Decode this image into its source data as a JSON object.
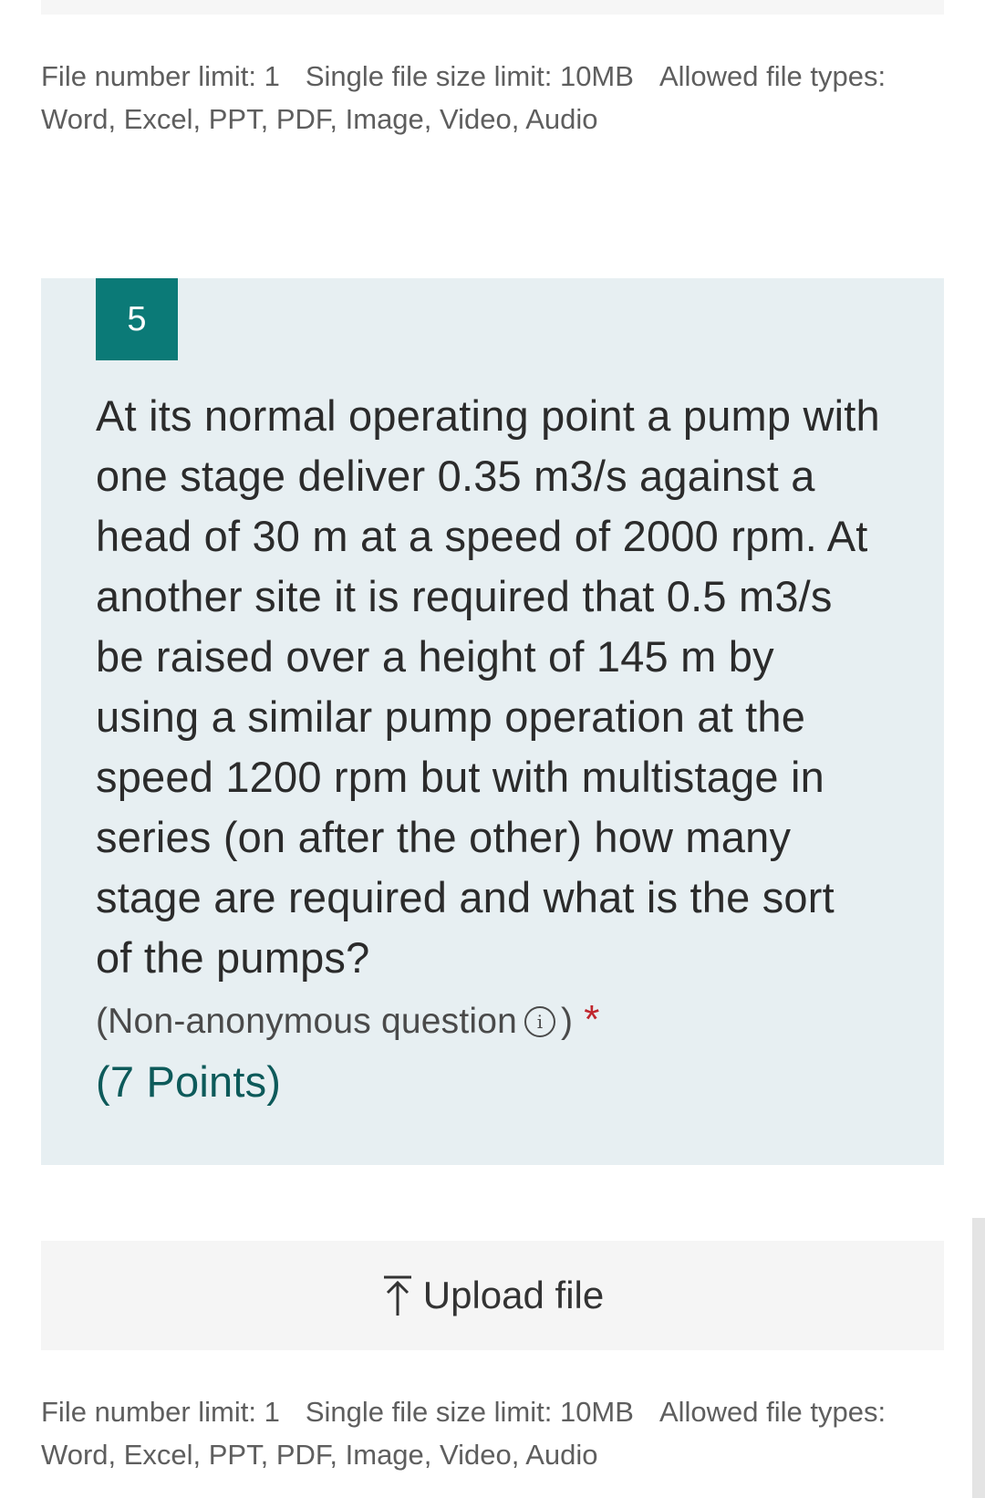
{
  "file_limits_top": {
    "number_limit": "File number limit: 1",
    "size_limit": "Single file size limit: 10MB",
    "types_label": "Allowed file types:",
    "types_value": "Word, Excel, PPT, PDF, Image, Video, Audio"
  },
  "question": {
    "number": "5",
    "text": "At its normal operating point a pump with one stage deliver 0.35 m3/s against a head of 30 m at a speed of 2000 rpm. At another site it is required that 0.5 m3/s be raised over a height of 145 m by using a similar pump operation at the  speed 1200 rpm but with multistage in series (on after the other) how many stage are required and what is the sort of the pumps?",
    "meta_open": "(Non-anonymous question",
    "info_icon_glyph": "i",
    "meta_close": ")",
    "required_mark": "*",
    "points": "(7 Points)"
  },
  "upload": {
    "label": "Upload file",
    "icon": "upload-arrow-icon"
  },
  "file_limits_bottom": {
    "number_limit": "File number limit: 1",
    "size_limit": "Single file size limit: 10MB",
    "types_label": "Allowed file types:",
    "types_value": "Word, Excel, PPT, PDF, Image, Video, Audio"
  },
  "colors": {
    "question_badge": "#0b7a77",
    "question_card_bg": "#e7eff2",
    "required_star": "#c0262d",
    "points_text": "#0d5a5a"
  }
}
